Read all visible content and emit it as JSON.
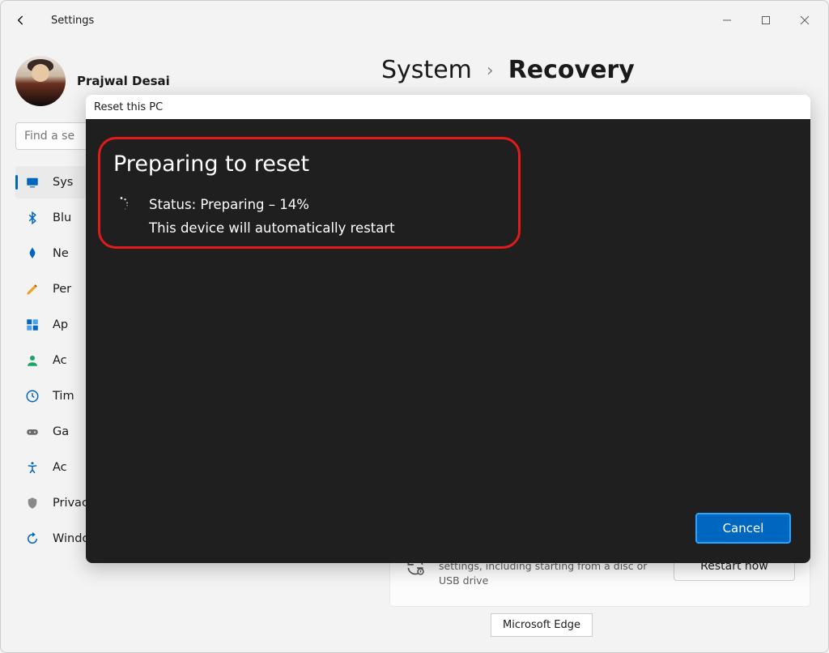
{
  "app_title": "Settings",
  "user": {
    "name": "Prajwal Desai"
  },
  "search": {
    "placeholder": "Find a se"
  },
  "breadcrumb": {
    "root": "System",
    "sep": "›",
    "leaf": "Recovery"
  },
  "sidebar": {
    "items": [
      {
        "label": "Sys",
        "icon": "system"
      },
      {
        "label": "Blu",
        "icon": "bluetooth"
      },
      {
        "label": "Ne",
        "icon": "network"
      },
      {
        "label": "Per",
        "icon": "personalization"
      },
      {
        "label": "Ap",
        "icon": "apps"
      },
      {
        "label": "Ac",
        "icon": "accounts"
      },
      {
        "label": "Tim",
        "icon": "time"
      },
      {
        "label": "Ga",
        "icon": "gaming"
      },
      {
        "label": "Ac",
        "icon": "accessibility"
      },
      {
        "label": "Privacy & security",
        "icon": "privacy"
      },
      {
        "label": "Windows Update",
        "icon": "update"
      }
    ]
  },
  "modal": {
    "title": "Reset this PC",
    "heading": "Preparing to reset",
    "status_label": "Status: Preparing – 14%",
    "helper": "This device will automatically restart",
    "cancel_label": "Cancel"
  },
  "recovery_card": {
    "text": "Restart your device to change startup settings, including starting from a disc or USB drive",
    "button_label": "Restart now"
  },
  "tooltip": {
    "label": "Microsoft Edge"
  },
  "progress_percent": 14
}
